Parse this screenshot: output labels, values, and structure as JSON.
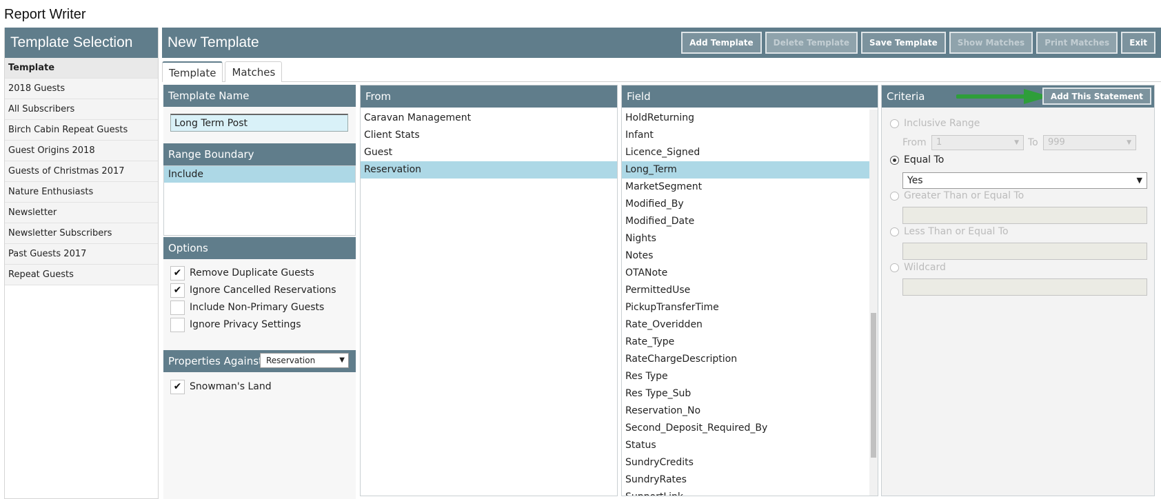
{
  "app": {
    "title": "Report Writer"
  },
  "sidebar": {
    "title": "Template Selection",
    "items": [
      {
        "label": "Template"
      },
      {
        "label": "2018 Guests"
      },
      {
        "label": "All Subscribers"
      },
      {
        "label": "Birch Cabin Repeat Guests"
      },
      {
        "label": "Guest Origins 2018"
      },
      {
        "label": "Guests of Christmas 2017"
      },
      {
        "label": "Nature Enthusiasts"
      },
      {
        "label": "Newsletter"
      },
      {
        "label": "Newsletter Subscribers"
      },
      {
        "label": "Past Guests 2017"
      },
      {
        "label": "Repeat Guests"
      }
    ]
  },
  "main": {
    "title": "New Template",
    "toolbar": {
      "add": "Add Template",
      "delete": "Delete Template",
      "save": "Save Template",
      "show": "Show Matches",
      "print": "Print Matches",
      "exit": "Exit"
    },
    "tabs": [
      {
        "label": "Template"
      },
      {
        "label": "Matches"
      }
    ]
  },
  "template_name": {
    "header": "Template Name",
    "value": "Long Term Post"
  },
  "range_boundary": {
    "header": "Range Boundary",
    "selected": "Include"
  },
  "options": {
    "header": "Options",
    "items": [
      {
        "label": "Remove Duplicate Guests",
        "mark": "✔"
      },
      {
        "label": "Ignore Cancelled Reservations",
        "mark": "✔"
      },
      {
        "label": "Include Non-Primary Guests",
        "mark": ""
      },
      {
        "label": "Ignore Privacy Settings",
        "mark": ""
      }
    ]
  },
  "properties": {
    "header": "Properties Against",
    "selected": "Reservation",
    "items": [
      {
        "label": "Snowman's Land",
        "mark": "✔"
      }
    ]
  },
  "from": {
    "header": "From",
    "items": [
      "Caravan Management",
      "Client Stats",
      "Guest",
      "Reservation"
    ],
    "selected": "Reservation"
  },
  "field": {
    "header": "Field",
    "items": [
      "HoldReturning",
      "Infant",
      "Licence_Signed",
      "Long_Term",
      "MarketSegment",
      "Modified_By",
      "Modified_Date",
      "Nights",
      "Notes",
      "OTANote",
      "PermittedUse",
      "PickupTransferTime",
      "Rate_Overidden",
      "Rate_Type",
      "RateChargeDescription",
      "Res Type",
      "Res Type_Sub",
      "Reservation_No",
      "Second_Deposit_Required_By",
      "Status",
      "SundryCredits",
      "SundryRates",
      "SupportLink"
    ],
    "selected": "Long_Term"
  },
  "criteria": {
    "header": "Criteria",
    "add_button": "Add This Statement",
    "inclusive_range": "Inclusive Range",
    "from_label": "From",
    "from_value": "1",
    "to_label": "To",
    "to_value": "999",
    "equal_to": "Equal To",
    "equal_value": "Yes",
    "gte": "Greater Than or Equal To",
    "lte": "Less Than or Equal To",
    "wildcard": "Wildcard",
    "arrow_color": "#2e9e3a"
  }
}
